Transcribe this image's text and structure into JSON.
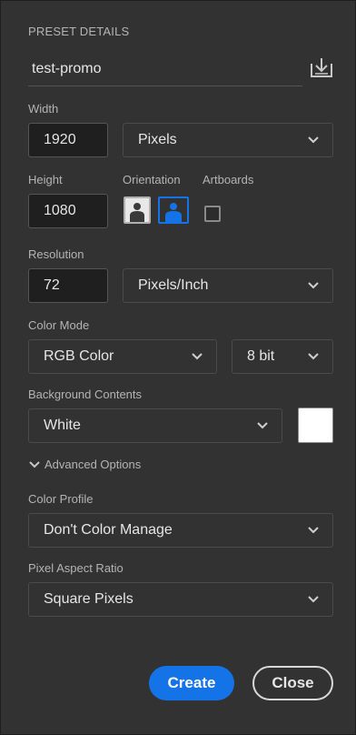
{
  "preset_details": {
    "title": "PRESET DETAILS",
    "name_value": "test-promo",
    "save_icon": "save-preset-icon"
  },
  "width": {
    "label": "Width",
    "value": "1920",
    "unit": "Pixels"
  },
  "height": {
    "label": "Height",
    "value": "1080"
  },
  "orientation": {
    "label": "Orientation",
    "portrait_icon": "portrait-icon",
    "landscape_icon": "landscape-icon",
    "selected": "landscape"
  },
  "artboards": {
    "label": "Artboards",
    "checked": false
  },
  "resolution": {
    "label": "Resolution",
    "value": "72",
    "unit": "Pixels/Inch"
  },
  "color_mode": {
    "label": "Color Mode",
    "mode": "RGB Color",
    "depth": "8 bit"
  },
  "background": {
    "label": "Background Contents",
    "value": "White",
    "swatch_color": "#ffffff"
  },
  "advanced": {
    "label": "Advanced Options",
    "expanded": true
  },
  "color_profile": {
    "label": "Color Profile",
    "value": "Don't Color Manage"
  },
  "pixel_aspect": {
    "label": "Pixel Aspect Ratio",
    "value": "Square Pixels"
  },
  "actions": {
    "create_label": "Create",
    "close_label": "Close"
  },
  "colors": {
    "panel_bg": "#323232",
    "accent": "#1473e6",
    "text": "#e6e6e6"
  }
}
